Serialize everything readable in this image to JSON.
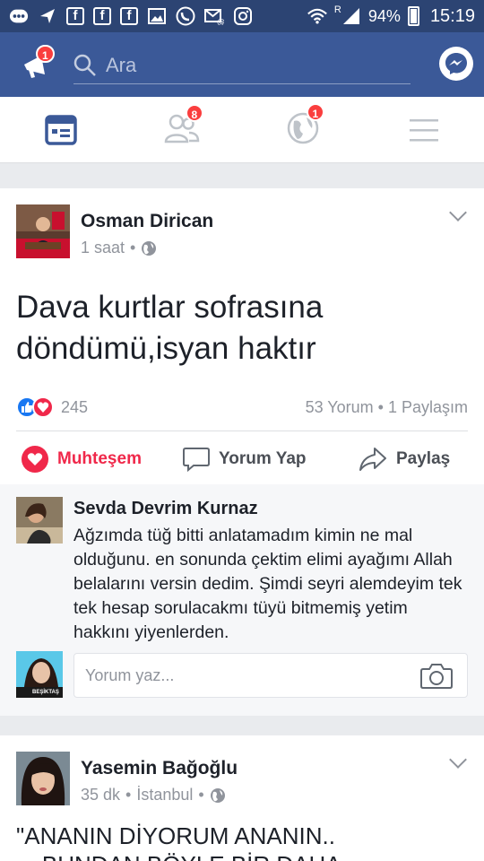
{
  "status_bar": {
    "icons": [
      "chat-dots-icon",
      "send-icon",
      "facebook-icon",
      "facebook-icon",
      "facebook-icon",
      "gallery-icon",
      "phone-icon",
      "email-icon",
      "instagram-icon",
      "wifi-icon",
      "signal-icon"
    ],
    "signal_label": "R",
    "battery": "94%",
    "time": "15:19"
  },
  "header": {
    "search_placeholder": "Ara",
    "notify_badge": "1"
  },
  "nav": {
    "friends_badge": "8",
    "globe_badge": "1"
  },
  "post1": {
    "author": "Osman Dirican",
    "time": "1 saat",
    "separator": "•",
    "text": "Dava kurtlar sofrasına döndümü,isyan haktır",
    "reaction_count": "245",
    "stats": "53 Yorum • 1 Paylaşım",
    "actions": {
      "react": "Muhteşem",
      "comment": "Yorum Yap",
      "share": "Paylaş"
    }
  },
  "comment": {
    "author": "Sevda Devrim Kurnaz",
    "text": "Ağzımda tüğ bitti anlatamadım kimin ne mal olduğunu. en sonunda çektim elimi ayağımı Allah belalarını versin dedim. Şimdi seyri alemdeyim tek tek hesap sorulacakmı tüyü bitmemiş yetim hakkını yiyenlerden.",
    "write_placeholder": "Yorum yaz...",
    "avatar_caption": "BEŞİKTAŞ"
  },
  "post2": {
    "author": "Yasemin Bağoğlu",
    "time": "35 dk",
    "location": "İstanbul",
    "separator": "•",
    "text_line1": "\"ANANIN DİYORUM ANANIN..",
    "text_line2": "....BUNDAN BÖYLE BİR DAHA"
  },
  "colors": {
    "brand": "#3b5998",
    "status_bar": "#2c4473",
    "love": "#f0284a",
    "like": "#1877f2",
    "badge": "#fa3e3e"
  }
}
